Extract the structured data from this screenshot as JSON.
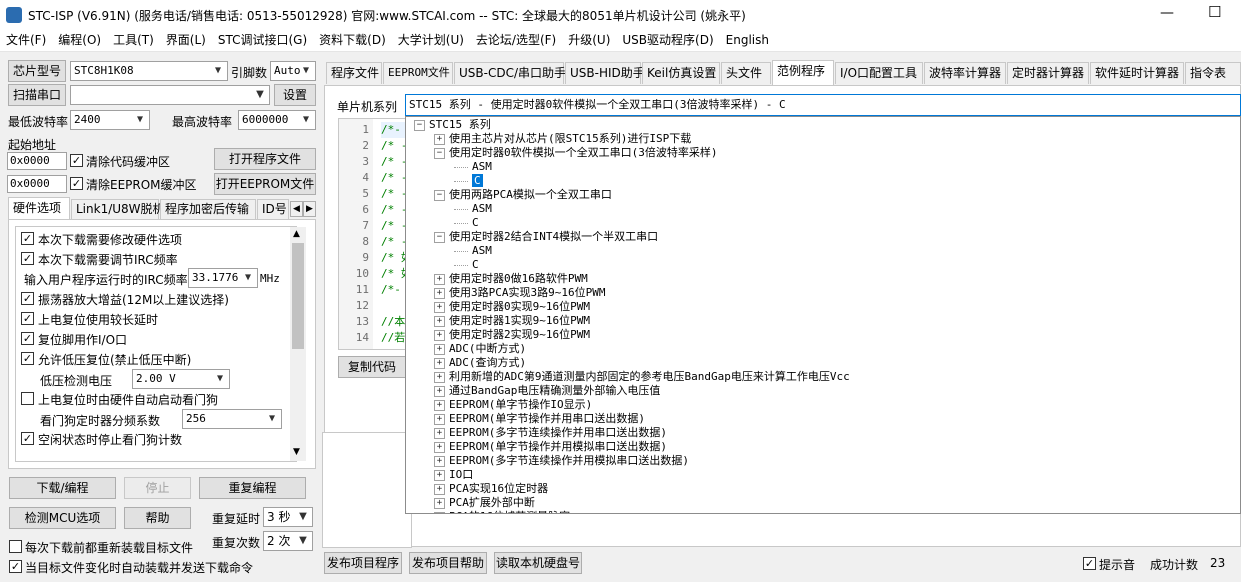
{
  "window": {
    "title": "STC-ISP (V6.91N) (服务电话/销售电话: 0513-55012928) 官网:www.STCAI.com  -- STC: 全球最大的8051单片机设计公司 (姚永平)",
    "min_symbol": "—",
    "max_symbol": "☐"
  },
  "menu": [
    "文件(F)",
    "编程(O)",
    "工具(T)",
    "界面(L)",
    "STC调试接口(G)",
    "资料下载(D)",
    "大学计划(U)",
    "去论坛/选型(F)",
    "升级(U)",
    "USB驱动程序(D)",
    "English"
  ],
  "left": {
    "chip_label": "芯片型号",
    "chip_value": "STC8H1K08",
    "ref_label": "引脚数",
    "ref_value": "Auto",
    "scan_port": "扫描串口",
    "port_value": "",
    "settings": "设置",
    "min_baud_label": "最低波特率",
    "min_baud_value": "2400",
    "max_baud_label": "最高波特率",
    "max_baud_value": "6000000",
    "start_addr_label": "起始地址",
    "addr1": "0x0000",
    "clear_code": "清除代码缓冲区",
    "open_prog": "打开程序文件",
    "addr2": "0x0000",
    "clear_eeprom": "清除EEPROM缓冲区",
    "open_eeprom": "打开EEPROM文件",
    "tabs": [
      "硬件选项",
      "Link1/U8W脱机",
      "程序加密后传输",
      "ID号"
    ],
    "options": [
      {
        "label": "本次下载需要修改硬件选项",
        "checked": true
      },
      {
        "label": "本次下载需要调节IRC频率",
        "checked": true
      },
      {
        "label": "振荡器放大增益(12M以上建议选择)",
        "checked": true
      },
      {
        "label": "上电复位使用较长延时",
        "checked": true
      },
      {
        "label": "复位脚用作I/O口",
        "checked": true
      },
      {
        "label": "允许低压复位(禁止低压中断)",
        "checked": true
      },
      {
        "label": "上电复位时由硬件自动启动看门狗",
        "checked": false
      },
      {
        "label": "空闲状态时停止看门狗计数",
        "checked": true
      }
    ],
    "irc_label": "输入用户程序运行时的IRC频率",
    "irc_value": "33.1776",
    "irc_unit": "MHz",
    "lvd_label": "低压检测电压",
    "lvd_value": "2.00 V",
    "wdt_label": "看门狗定时器分频系数",
    "wdt_value": "256",
    "download": "下载/编程",
    "stop": "停止",
    "reprogram": "重复编程",
    "check_mcu": "检测MCU选项",
    "help": "帮助",
    "retry_delay_label": "重复延时",
    "retry_delay_value": "3 秒",
    "retry_count_label": "重复次数",
    "retry_count_value": "2 次",
    "reload_label": "每次下载前都重新装载目标文件",
    "reload_checked": false,
    "auto_label": "当目标文件变化时自动装载并发送下载命令",
    "auto_checked": true
  },
  "right": {
    "tabs": [
      "程序文件",
      "EEPROM文件",
      "USB-CDC/串口助手",
      "USB-HID助手",
      "Keil仿真设置",
      "头文件",
      "范例程序",
      "I/O口配置工具",
      "波特率计算器",
      "定时器计算器",
      "软件延时计算器",
      "指令表"
    ],
    "series_label": "单片机系列",
    "series_value": "STC15 系列 - 使用定时器0软件模拟一个全双工串口(3倍波特率采样) - C",
    "line_numbers": [
      "1",
      "2",
      "3",
      "4",
      "5",
      "6",
      "7",
      "8",
      "9",
      "10",
      "11",
      "12",
      "13",
      "14"
    ],
    "code_lines": [
      "/*-",
      "/* -",
      "/* -",
      "/* -",
      "/* -",
      "/* -",
      "/* -",
      "/* -",
      "/* 如",
      "/* 如",
      "/*-",
      "",
      "//本",
      "//若"
    ],
    "copy_code": "复制代码",
    "tree": [
      {
        "indent": 0,
        "pm": "−",
        "text": "STC15 系列"
      },
      {
        "indent": 1,
        "pm": "+",
        "text": "使用主芯片对从芯片(限STC15系列)进行ISP下载"
      },
      {
        "indent": 1,
        "pm": "−",
        "text": "使用定时器0软件模拟一个全双工串口(3倍波特率采样)"
      },
      {
        "indent": 2,
        "pm": "",
        "text": "ASM"
      },
      {
        "indent": 2,
        "pm": "",
        "text": "C",
        "selected": true
      },
      {
        "indent": 1,
        "pm": "−",
        "text": "使用两路PCA模拟一个全双工串口"
      },
      {
        "indent": 2,
        "pm": "",
        "text": "ASM"
      },
      {
        "indent": 2,
        "pm": "",
        "text": "C"
      },
      {
        "indent": 1,
        "pm": "−",
        "text": "使用定时器2结合INT4模拟一个半双工串口"
      },
      {
        "indent": 2,
        "pm": "",
        "text": "ASM"
      },
      {
        "indent": 2,
        "pm": "",
        "text": "C"
      },
      {
        "indent": 1,
        "pm": "+",
        "text": "使用定时器0做16路软件PWM"
      },
      {
        "indent": 1,
        "pm": "+",
        "text": "使用3路PCA实现3路9~16位PWM"
      },
      {
        "indent": 1,
        "pm": "+",
        "text": "使用定时器0实现9~16位PWM"
      },
      {
        "indent": 1,
        "pm": "+",
        "text": "使用定时器1实现9~16位PWM"
      },
      {
        "indent": 1,
        "pm": "+",
        "text": "使用定时器2实现9~16位PWM"
      },
      {
        "indent": 1,
        "pm": "+",
        "text": "ADC(中断方式)"
      },
      {
        "indent": 1,
        "pm": "+",
        "text": "ADC(查询方式)"
      },
      {
        "indent": 1,
        "pm": "+",
        "text": "利用新增的ADC第9通道测量内部固定的参考电压BandGap电压来计算工作电压Vcc"
      },
      {
        "indent": 1,
        "pm": "+",
        "text": "通过BandGap电压精确测量外部输入电压值"
      },
      {
        "indent": 1,
        "pm": "+",
        "text": "EEPROM(单字节操作IO显示)"
      },
      {
        "indent": 1,
        "pm": "+",
        "text": "EEPROM(单字节操作并用串口送出数据)"
      },
      {
        "indent": 1,
        "pm": "+",
        "text": "EEPROM(多字节连续操作并用串口送出数据)"
      },
      {
        "indent": 1,
        "pm": "+",
        "text": "EEPROM(单字节操作并用模拟串口送出数据)"
      },
      {
        "indent": 1,
        "pm": "+",
        "text": "EEPROM(多字节连续操作并用模拟串口送出数据)"
      },
      {
        "indent": 1,
        "pm": "+",
        "text": "IO口"
      },
      {
        "indent": 1,
        "pm": "+",
        "text": "PCA实现16位定时器"
      },
      {
        "indent": 1,
        "pm": "+",
        "text": "PCA扩展外部中断"
      },
      {
        "indent": 1,
        "pm": "+",
        "text": "PCA的16位捕获测量脉宽"
      }
    ],
    "publish_prog": "发布项目程序",
    "publish_help": "发布项目帮助",
    "read_disk": "读取本机硬盘号",
    "sound_label": "提示音",
    "sound_checked": true,
    "success_label": "成功计数",
    "success_value": "23"
  }
}
